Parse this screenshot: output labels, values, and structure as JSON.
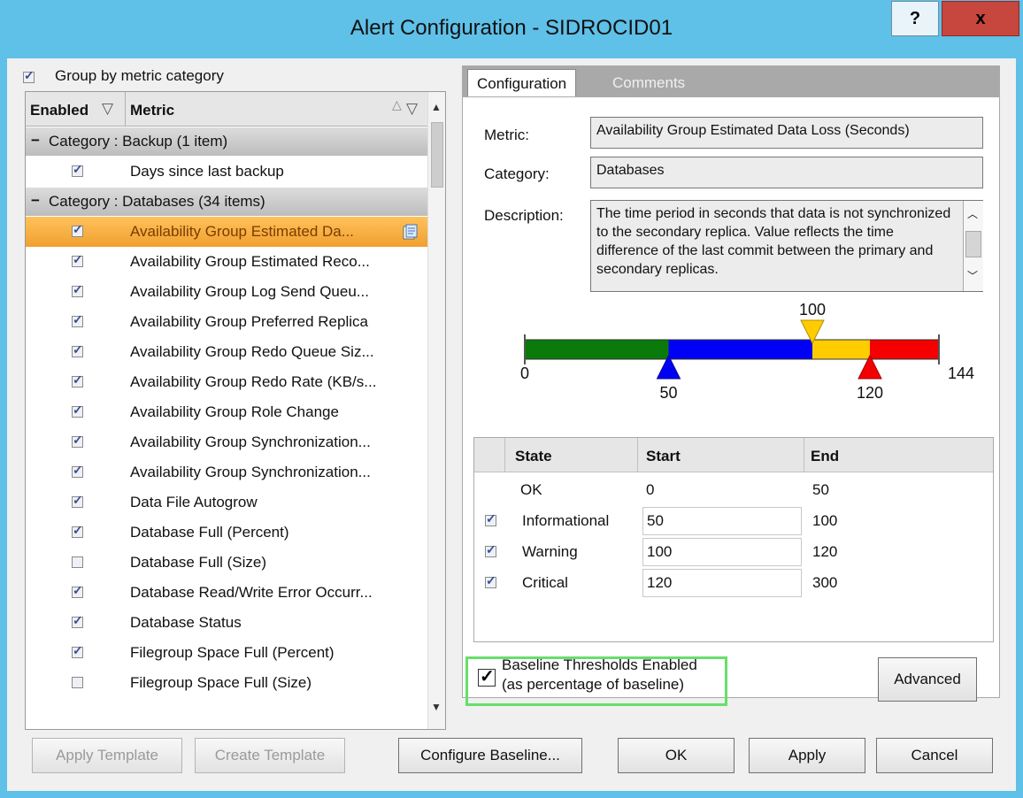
{
  "window": {
    "title": "Alert Configuration - SIDROCID01",
    "help_label": "?",
    "close_label": "x"
  },
  "left": {
    "group_by_label": "Group by metric category",
    "columns": {
      "enabled": "Enabled",
      "metric": "Metric"
    },
    "categories": [
      {
        "label": "Category : Backup (1 item)"
      },
      {
        "label": "Category : Databases (34 items)"
      }
    ],
    "backup_items": [
      {
        "metric": "Days since last backup",
        "enabled": true
      }
    ],
    "database_items": [
      {
        "metric": "Availability Group Estimated Da...",
        "enabled": true,
        "selected": true
      },
      {
        "metric": "Availability Group Estimated Reco...",
        "enabled": true
      },
      {
        "metric": "Availability Group Log Send Queu...",
        "enabled": true
      },
      {
        "metric": "Availability Group Preferred Replica",
        "enabled": true
      },
      {
        "metric": "Availability Group Redo Queue Siz...",
        "enabled": true
      },
      {
        "metric": "Availability Group Redo Rate (KB/s...",
        "enabled": true
      },
      {
        "metric": "Availability Group Role Change",
        "enabled": true
      },
      {
        "metric": "Availability Group Synchronization...",
        "enabled": true
      },
      {
        "metric": "Availability Group Synchronization...",
        "enabled": true
      },
      {
        "metric": "Data File Autogrow",
        "enabled": true
      },
      {
        "metric": "Database Full (Percent)",
        "enabled": true
      },
      {
        "metric": "Database Full (Size)",
        "enabled": false
      },
      {
        "metric": "Database Read/Write Error Occurr...",
        "enabled": true
      },
      {
        "metric": "Database Status",
        "enabled": true
      },
      {
        "metric": "Filegroup Space Full (Percent)",
        "enabled": true
      },
      {
        "metric": "Filegroup Space Full (Size)",
        "enabled": false
      }
    ]
  },
  "tabs": {
    "configuration": "Configuration",
    "comments": "Comments"
  },
  "config": {
    "metric_label": "Metric:",
    "metric_value": "Availability Group Estimated Data Loss (Seconds)",
    "category_label": "Category:",
    "category_value": "Databases",
    "description_label": "Description:",
    "description_value": "The time period in seconds that data is not synchronized to the secondary replica.  Value reflects the time difference of the last commit between the primary and secondary replicas."
  },
  "threshold": {
    "min": 0,
    "max": 144,
    "informational": 50,
    "warning": 100,
    "critical": 120,
    "colors": {
      "ok": "#0a7a0a",
      "informational": "#0000f5",
      "warning": "#ffcc00",
      "critical": "#f50000"
    },
    "labels": {
      "min": "0",
      "max": "144",
      "informational": "50",
      "warning": "100",
      "critical": "120"
    }
  },
  "state_table": {
    "headers": {
      "state": "State",
      "start": "Start",
      "end": "End"
    },
    "rows": [
      {
        "state": "OK",
        "start": "0",
        "end": "50",
        "has_check": false
      },
      {
        "state": "Informational",
        "start": "50",
        "end": "100",
        "has_check": true,
        "checked": true
      },
      {
        "state": "Warning",
        "start": "100",
        "end": "120",
        "has_check": true,
        "checked": true
      },
      {
        "state": "Critical",
        "start": "120",
        "end": "300",
        "has_check": true,
        "checked": true
      }
    ]
  },
  "baseline": {
    "line1": "Baseline Thresholds Enabled",
    "line2": "(as percentage of baseline)",
    "checked": true,
    "highlight_color": "#66e06a"
  },
  "buttons": {
    "advanced": "Advanced",
    "apply_template": "Apply Template",
    "create_template": "Create Template",
    "configure_baseline": "Configure Baseline...",
    "ok": "OK",
    "apply": "Apply",
    "cancel": "Cancel"
  }
}
